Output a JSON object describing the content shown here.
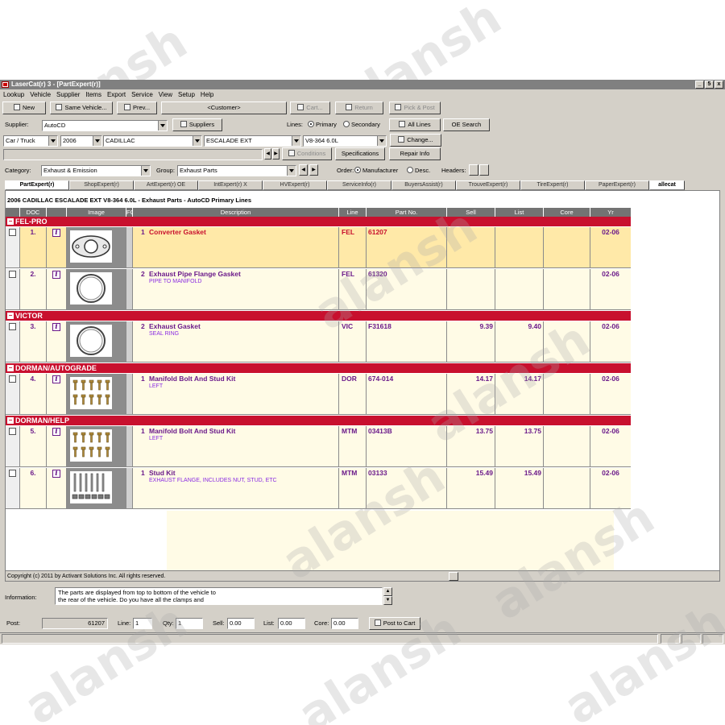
{
  "window": {
    "title": "LaserCat(r) 3 - [PartExpert(r)]",
    "controls": [
      "_",
      "5",
      "x"
    ]
  },
  "menu": [
    "Lookup",
    "Vehicle",
    "Supplier",
    "Items",
    "Export",
    "Service",
    "View",
    "Setup",
    "Help"
  ],
  "toolbar": {
    "new": "New",
    "same_vehicle": "Same Vehicle...",
    "prev": "Prev...",
    "customer": "<Customer>",
    "cart": "Cart...",
    "return": "Return",
    "pick_post": "Pick & Post"
  },
  "supplier_row": {
    "label": "Supplier:",
    "value": "AutoCD",
    "suppliers_button": "Suppliers",
    "lines_label": "Lines:",
    "primary": "Primary",
    "secondary": "Secondary",
    "all_lines": "All Lines",
    "oe_search": "OE Search"
  },
  "vehicle_row": {
    "type": "Car / Truck",
    "year": "2006",
    "make": "CADILLAC",
    "model": "ESCALADE EXT",
    "engine": "V8-364 6.0L",
    "change": "Change...",
    "conditions": "Conditions",
    "specifications": "Specifications",
    "repair_info": "Repair Info"
  },
  "category_row": {
    "category_label": "Category:",
    "category_value": "Exhaust & Emission",
    "group_label": "Group:",
    "group_value": "Exhaust Parts",
    "order_label": "Order:",
    "manufacturer": "Manufacturer",
    "desc": "Desc.",
    "headers_label": "Headers:"
  },
  "tabs": [
    "PartExpert(r)",
    "ShopExpert(r)",
    "ArtExpert(r) OE",
    "IntExpert(r) X",
    "HVExpert(r)",
    "ServiceInfo(r)",
    "BuyersAssist(r)",
    "TrouveExpert(r)",
    "TireExpert(r)",
    "PaperExpert(r)",
    "allecat"
  ],
  "listing": {
    "header": "2006 CADILLAC ESCALADE EXT V8-364 6.0L  -  Exhaust Parts  -  AutoCD Primary Lines",
    "columns": [
      "",
      "DOC",
      "Image",
      "FC",
      "Description",
      "Line",
      "Part No.",
      "Sell",
      "List",
      "Core",
      "Yr"
    ],
    "groups": [
      {
        "name": "FEL-PRO",
        "rows": [
          {
            "no": "1.",
            "fc": "1",
            "title": "Converter Gasket",
            "sub": "",
            "line": "FEL",
            "part": "61207",
            "sell": "",
            "list": "",
            "core": "",
            "yr": "02-06",
            "selected": true,
            "thumb": "gasket-oval"
          },
          {
            "no": "2.",
            "fc": "2",
            "title": "Exhaust Pipe Flange Gasket",
            "sub": "PIPE TO MANIFOLD",
            "line": "FEL",
            "part": "61320",
            "sell": "",
            "list": "",
            "core": "",
            "yr": "02-06",
            "selected": false,
            "thumb": "ring"
          }
        ]
      },
      {
        "name": "VICTOR",
        "rows": [
          {
            "no": "3.",
            "fc": "2",
            "title": "Exhaust Gasket",
            "sub": "SEAL RING",
            "line": "VIC",
            "part": "F31618",
            "sell": "9.39",
            "list": "9.40",
            "core": "",
            "yr": "02-06",
            "selected": false,
            "thumb": "ring"
          }
        ]
      },
      {
        "name": "DORMAN/AUTOGRADE",
        "rows": [
          {
            "no": "4.",
            "fc": "1",
            "title": "Manifold Bolt And Stud Kit",
            "sub": "LEFT",
            "line": "DOR",
            "part": "674-014",
            "sell": "14.17",
            "list": "14.17",
            "core": "",
            "yr": "02-06",
            "selected": false,
            "thumb": "bolts"
          }
        ]
      },
      {
        "name": "DORMAN/HELP",
        "rows": [
          {
            "no": "5.",
            "fc": "1",
            "title": "Manifold Bolt And Stud Kit",
            "sub": "LEFT",
            "line": "MTM",
            "part": "03413B",
            "sell": "13.75",
            "list": "13.75",
            "core": "",
            "yr": "02-06",
            "selected": false,
            "thumb": "bolts"
          },
          {
            "no": "6.",
            "fc": "1",
            "title": "Stud Kit",
            "sub": "EXHAUST FLANGE, INCLUDES NUT, STUD, ETC",
            "line": "MTM",
            "part": "03133",
            "sell": "15.49",
            "list": "15.49",
            "core": "",
            "yr": "02-06",
            "selected": false,
            "thumb": "studs"
          }
        ]
      }
    ]
  },
  "status": {
    "copyright": "Copyright (c) 2011 by Activant Solutions Inc. All rights reserved."
  },
  "information": {
    "label": "Information:",
    "text_line1": "The parts are displayed from top to bottom of the vehicle to",
    "text_line2": "the rear of the vehicle. Do you have all the clamps and"
  },
  "post_row": {
    "post_label": "Post:",
    "post_value": "61207",
    "line_label": "Line:",
    "line_value": "1",
    "qty_label": "Qty:",
    "qty_value": "1",
    "sell_label": "Sell:",
    "sell_value": "0.00",
    "list_label": "List:",
    "list_value": "0.00",
    "core_label": "Core:",
    "core_value": "0.00",
    "post_button": "Post to Cart"
  },
  "watermark_text": "alansh"
}
